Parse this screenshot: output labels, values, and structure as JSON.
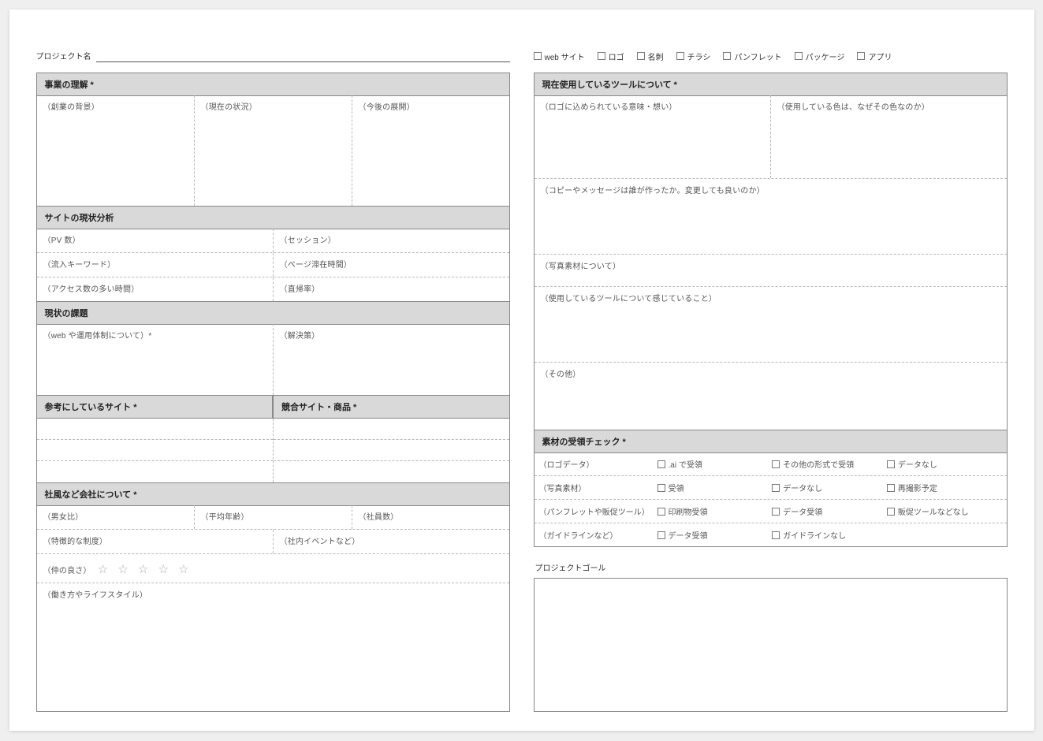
{
  "header": {
    "project_label": "プロジェクト名",
    "types": [
      "web サイト",
      "ロゴ",
      "名刺",
      "チラシ",
      "パンフレット",
      "パッケージ",
      "アプリ"
    ]
  },
  "left": {
    "business": {
      "title": "事業の理解 *",
      "cols": [
        "（創業の背景）",
        "（現在の状況）",
        "（今後の展開）"
      ]
    },
    "site_analysis": {
      "title": "サイトの現状分析",
      "rows": [
        [
          "（PV 数）",
          "（セッション）"
        ],
        [
          "（流入キーワード）",
          "（ページ滞在時間）"
        ],
        [
          "（アクセス数の多い時間）",
          "（直帰率）"
        ]
      ]
    },
    "issues": {
      "title": "現状の課題",
      "cols": [
        "（web や運用体制について）*",
        "（解決策）"
      ]
    },
    "ref_title": "参考にしているサイト *",
    "comp_title": "競合サイト・商品 *",
    "company": {
      "title": "社風など会社について *",
      "row1": [
        "（男女比）",
        "（平均年齢）",
        "（社員数）"
      ],
      "row2": [
        "（特徴的な制度）",
        "（社内イベントなど）"
      ],
      "closeness_label": "（仲の良さ）",
      "stars": "☆ ☆ ☆ ☆ ☆",
      "lifestyle": "（働き方やライフスタイル）"
    }
  },
  "right": {
    "tools": {
      "title": "現在使用しているツールについて *",
      "row1": [
        "（ロゴに込められている意味・想い）",
        "（使用している色は、なぜその色なのか）"
      ],
      "copy": "（コピーやメッセージは誰が作ったか。変更しても良いのか）",
      "photo": "（写真素材について）",
      "feeling": "（使用しているツールについて感じていること）",
      "other": "（その他）"
    },
    "assets": {
      "title": "素材の受領チェック *",
      "rows": [
        {
          "label": "（ロゴデータ）",
          "opts": [
            ".ai で受領",
            "その他の形式で受領",
            "データなし"
          ]
        },
        {
          "label": "（写真素材）",
          "opts": [
            "受領",
            "データなし",
            "再撮影予定"
          ]
        },
        {
          "label": "（パンフレットや販促ツール）",
          "opts": [
            "印刷物受領",
            "データ受領",
            "販促ツールなどなし"
          ]
        },
        {
          "label": "（ガイドラインなど）",
          "opts": [
            "データ受領",
            "ガイドラインなし",
            ""
          ]
        }
      ]
    },
    "goal_label": "プロジェクトゴール"
  }
}
